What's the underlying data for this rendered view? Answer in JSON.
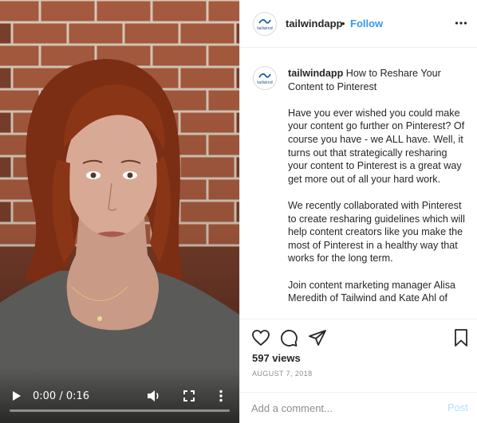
{
  "header": {
    "username": "tailwindapp",
    "separator": "•",
    "follow_label": "Follow",
    "avatar_label": "tailwind"
  },
  "video": {
    "time_display": "0:00 / 0:16",
    "progress": 0
  },
  "caption": {
    "username": "tailwindapp",
    "text": " How to Reshare Your Content to Pinterest\n\nHave you ever wished you could make your content go further on Pinterest? Of course you have - we ALL have. Well, it turns out that strategically resharing your content to Pinterest is a great way get more out of all your hard work.\n\nWe recently collaborated with Pinterest to create resharing guidelines which will help content creators like you make the most of Pinterest in a healthy way that works for the long term.\n\nJoin content marketing manager Alisa Meredith of Tailwind and Kate Ahl of"
  },
  "stats": {
    "views": "597 views",
    "date": "AUGUST 7, 2018"
  },
  "add_comment": {
    "placeholder": "Add a comment...",
    "post_label": "Post"
  },
  "colors": {
    "accent": "#3897f0",
    "post_disabled": "#b2dffc",
    "muted": "#8e8e8e"
  }
}
